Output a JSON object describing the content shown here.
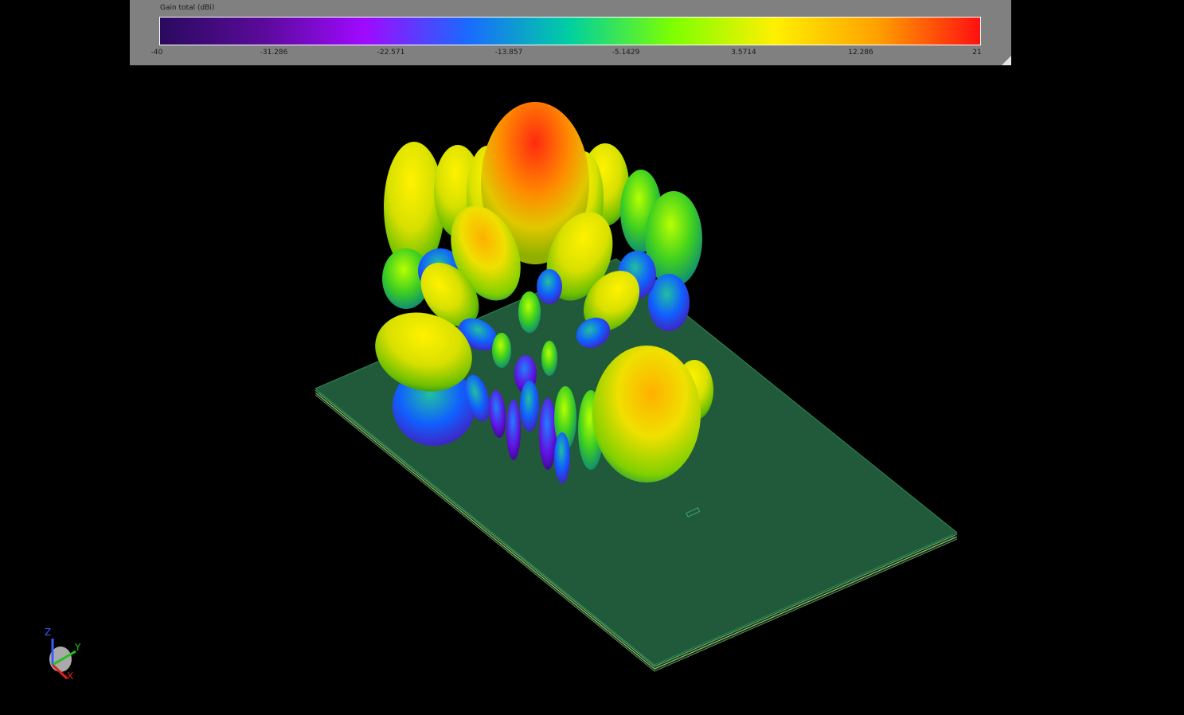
{
  "legend": {
    "title": "Gain total (dBi)",
    "ticks": [
      "-40",
      "-31.286",
      "-22.571",
      "-13.857",
      "-5.1429",
      "3.5714",
      "12.286",
      "21"
    ],
    "colormap": [
      "#2a0a5e",
      "#5a0a9a",
      "#a00aff",
      "#1a6aff",
      "#00d0a0",
      "#7dff00",
      "#fff000",
      "#ffa000",
      "#ff1010"
    ]
  },
  "axes": {
    "z": "Z",
    "y": "Y",
    "x": "X"
  },
  "colors": {
    "background": "#000000",
    "board": "#215a3a",
    "board_edge": "#2f8a55"
  }
}
